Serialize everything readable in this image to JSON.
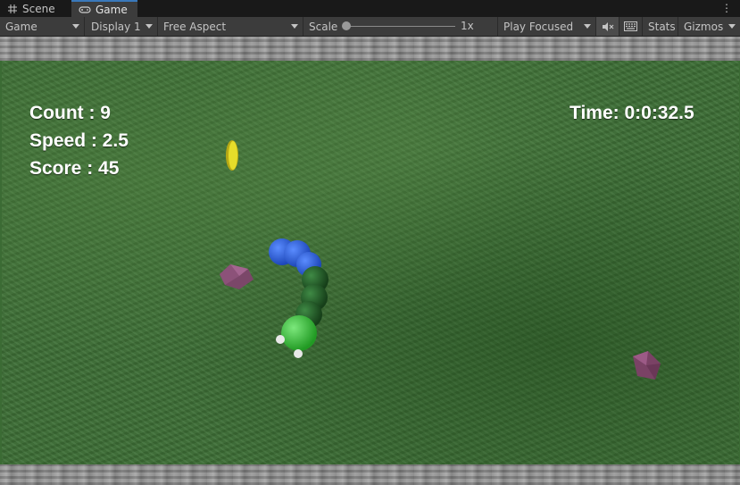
{
  "tabs": {
    "scene_label": "Scene",
    "game_label": "Game"
  },
  "toolbar": {
    "view_mode": "Game",
    "display": "Display 1",
    "aspect": "Free Aspect",
    "scale_label": "Scale",
    "scale_value": "1x",
    "play_mode": "Play Focused",
    "stats_label": "Stats",
    "gizmos_label": "Gizmos"
  },
  "hud": {
    "count": "Count : 9",
    "speed": "Speed : 2.5",
    "score": "Score : 45",
    "time": "Time: 0:0:32.5"
  },
  "colors": {
    "grass": "#3d6f36",
    "snake_head": "#3cbf3c",
    "snake_body_dark": "#1e5a22",
    "snake_tail": "#2b5fd8",
    "coin": "#d8d21c",
    "gem": "#8a4c74"
  },
  "icons": {
    "scene_tab": "grid-icon",
    "game_tab": "gamepad-icon",
    "mute": "mute-audio-icon",
    "stats": "keyboard-icon",
    "menu": "kebab-menu-icon"
  }
}
